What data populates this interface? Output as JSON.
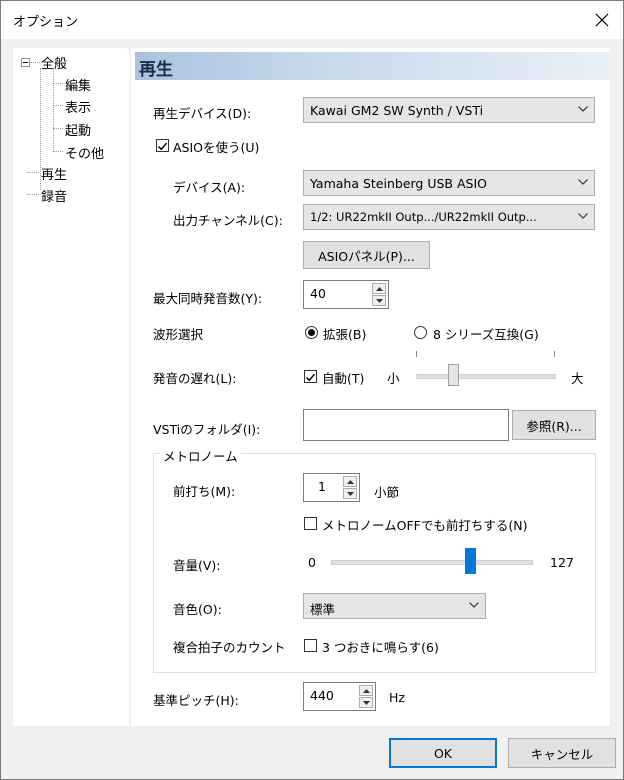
{
  "window": {
    "title": "オプション"
  },
  "tree": {
    "items": [
      {
        "label": "全般"
      },
      {
        "label": "編集"
      },
      {
        "label": "表示"
      },
      {
        "label": "起動"
      },
      {
        "label": "その他"
      },
      {
        "label": "再生"
      },
      {
        "label": "録音"
      }
    ]
  },
  "panel": {
    "header": "再生",
    "playback_device": {
      "label": "再生デバイス(D):",
      "value": "Kawai GM2 SW Synth / VSTi"
    },
    "use_asio": {
      "label": "ASIOを使う(U)",
      "checked": true
    },
    "asio_device": {
      "label": "デバイス(A):",
      "value": "Yamaha Steinberg USB ASIO"
    },
    "output_channel": {
      "label": "出力チャンネル(C):",
      "value": "1/2: UR22mkII Outp.../UR22mkII Outp..."
    },
    "asio_panel_button": "ASIOパネル(P)...",
    "max_polyphony": {
      "label": "最大同時発音数(Y):",
      "value": "40"
    },
    "waveform": {
      "label": "波形選択",
      "options": [
        {
          "label": "拡張(B)",
          "selected": true
        },
        {
          "label": "8 シリーズ互換(G)",
          "selected": false
        }
      ]
    },
    "latency": {
      "label": "発音の遅れ(L):",
      "auto_label": "自動(T)",
      "auto_checked": true,
      "min_label": "小",
      "max_label": "大",
      "level": 0.25
    },
    "vsti_folder": {
      "label": "VSTiのフォルダ(I):",
      "value": "",
      "browse_button": "参照(R)..."
    },
    "metronome": {
      "title": "メトロノーム",
      "count_in": {
        "label": "前打ち(M):",
        "value": "1",
        "unit": "小節"
      },
      "count_in_when_off": {
        "label": "メトロノームOFFでも前打ちする(N)",
        "checked": false
      },
      "volume": {
        "label": "音量(V):",
        "min": "0",
        "max": "127",
        "value": 90
      },
      "tone": {
        "label": "音色(O):",
        "value": "標準"
      },
      "compound_meter": {
        "label": "複合拍子のカウント",
        "check_label": "3 つおきに鳴らす(6)",
        "checked": false
      }
    },
    "reference_pitch": {
      "label": "基準ピッチ(H):",
      "value": "440",
      "unit": "Hz"
    }
  },
  "footer": {
    "ok": "OK",
    "cancel": "キャンセル"
  },
  "colors": {
    "accent": "#0078d7",
    "header_gradient_start": "#a9c3df"
  }
}
